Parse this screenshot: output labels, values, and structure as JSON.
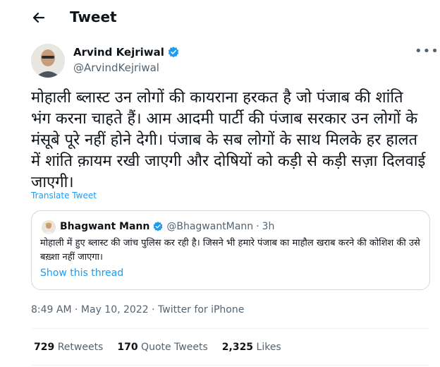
{
  "header": {
    "title": "Tweet"
  },
  "author": {
    "name": "Arvind Kejriwal",
    "handle": "@ArvindKejriwal",
    "verified": true
  },
  "tweet": {
    "text": "मोहाली ब्लास्ट उन लोगों की कायराना हरकत है जो पंजाब की शांति भंग करना चाहते हैं। आम आदमी पार्टी की पंजाब सरकार उन लोगों के मंसूबे पूरे नहीं होने देगी। पंजाब के सब लोगों के साथ मिलके हर हालत में शांति क़ायम रखी जाएगी और दोषियों को कड़ी से कड़ी सज़ा दिलवाई जाएगी।",
    "translate_label": "Translate Tweet"
  },
  "quote": {
    "name": "Bhagwant Mann",
    "handle": "@BhagwantMann",
    "separator": "·",
    "time": "3h",
    "text": "मोहाली में हुए ब्लास्ट की जांच पुलिस कर रही है। जिसने भी हमारे पंजाब का माहौल खराब करने की कोशिश की उसे बख़्शा नहीं जाएगा।",
    "show_thread_label": "Show this thread"
  },
  "meta": {
    "time": "8:49 AM",
    "separator1": "·",
    "date": "May 10, 2022",
    "separator2": "·",
    "source": "Twitter for iPhone"
  },
  "stats": {
    "retweets_count": "729",
    "retweets_label": "Retweets",
    "quotes_count": "170",
    "quotes_label": "Quote Tweets",
    "likes_count": "2,325",
    "likes_label": "Likes"
  },
  "colors": {
    "accent": "#1d9bf0",
    "text": "#0f1419",
    "secondary": "#536471",
    "border": "#cfd9de",
    "divider": "#eff3f4"
  },
  "icons": {
    "back": "back-arrow-icon",
    "verified": "verified-badge-icon",
    "more": "more-options-icon"
  }
}
